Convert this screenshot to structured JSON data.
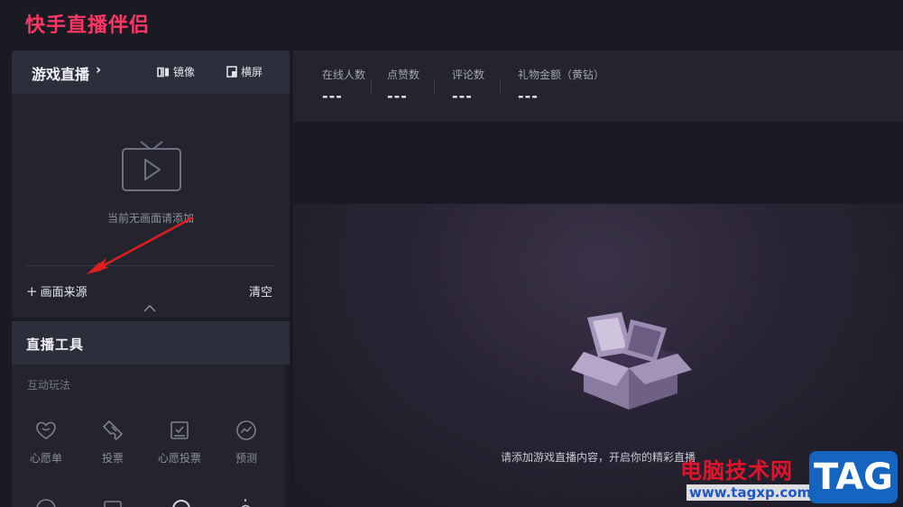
{
  "app": {
    "title": "快手直播伴侣"
  },
  "scene": {
    "title": "游戏直播",
    "chevron": "›",
    "mirror_label": "镜像",
    "landscape_label": "横屏",
    "empty_text": "当前无画面请添加",
    "add_source_label": "画面来源",
    "add_source_plus": "+",
    "clear_label": "清空"
  },
  "tools": {
    "title": "直播工具",
    "section_label": "互动玩法",
    "items": [
      {
        "label": "心愿单",
        "icon": "heart-chat-icon"
      },
      {
        "label": "投票",
        "icon": "ticket-icon"
      },
      {
        "label": "心愿投票",
        "icon": "vote-box-icon"
      },
      {
        "label": "预测",
        "icon": "trend-icon"
      }
    ]
  },
  "stats": [
    {
      "label": "在线人数",
      "value": "---"
    },
    {
      "label": "点赞数",
      "value": "---"
    },
    {
      "label": "评论数",
      "value": "---"
    },
    {
      "label": "礼物金额（黄钻）",
      "value": "---"
    }
  ],
  "preview": {
    "text": "请添加游戏直播内容，开启你的精彩直播"
  },
  "watermark": {
    "site_cn": "电脑技术网",
    "url": "www.tagxp.com",
    "tag": "TAG"
  },
  "colors": {
    "accent": "#fe3666",
    "panel": "#23242e",
    "header": "#2c2e3c",
    "arrow": "#e01e1e"
  }
}
